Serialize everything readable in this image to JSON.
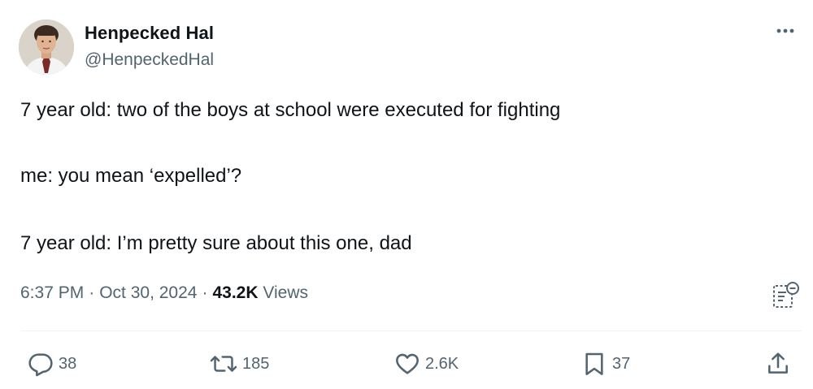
{
  "author": {
    "display_name": "Henpecked Hal",
    "handle": "@HenpeckedHal"
  },
  "tweet": {
    "lines": [
      "7 year old: two of the boys at school were executed for fighting",
      "me: you mean ‘expelled’?",
      "7 year old: I’m pretty sure about this one, dad"
    ]
  },
  "meta": {
    "time": "6:37 PM",
    "separator": "·",
    "date": "Oct 30, 2024",
    "views_count": "43.2K",
    "views_label": "Views"
  },
  "actions": {
    "replies": "38",
    "reposts": "185",
    "likes": "2.6K",
    "bookmarks": "37"
  },
  "icons": {
    "more": "more-horizontal-icon",
    "notes": "community-notes-icon",
    "reply": "reply-icon",
    "repost": "repost-icon",
    "like": "heart-icon",
    "bookmark": "bookmark-icon",
    "share": "share-icon"
  },
  "colors": {
    "text": "#0f1419",
    "secondary": "#536471",
    "divider": "#eff3f4"
  }
}
